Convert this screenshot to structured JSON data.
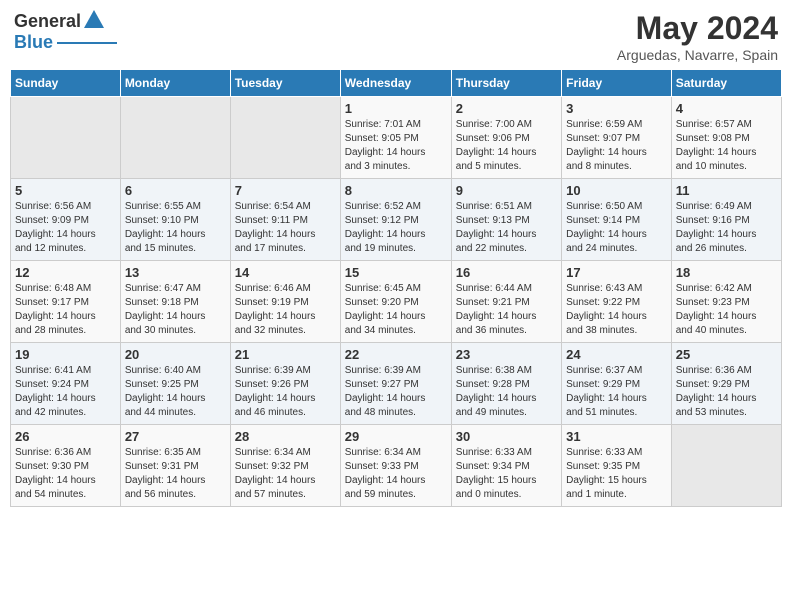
{
  "logo": {
    "general": "General",
    "blue": "Blue"
  },
  "header": {
    "title": "May 2024",
    "subtitle": "Arguedas, Navarre, Spain"
  },
  "columns": [
    "Sunday",
    "Monday",
    "Tuesday",
    "Wednesday",
    "Thursday",
    "Friday",
    "Saturday"
  ],
  "weeks": [
    [
      {
        "day": "",
        "info": ""
      },
      {
        "day": "",
        "info": ""
      },
      {
        "day": "",
        "info": ""
      },
      {
        "day": "1",
        "info": "Sunrise: 7:01 AM\nSunset: 9:05 PM\nDaylight: 14 hours\nand 3 minutes."
      },
      {
        "day": "2",
        "info": "Sunrise: 7:00 AM\nSunset: 9:06 PM\nDaylight: 14 hours\nand 5 minutes."
      },
      {
        "day": "3",
        "info": "Sunrise: 6:59 AM\nSunset: 9:07 PM\nDaylight: 14 hours\nand 8 minutes."
      },
      {
        "day": "4",
        "info": "Sunrise: 6:57 AM\nSunset: 9:08 PM\nDaylight: 14 hours\nand 10 minutes."
      }
    ],
    [
      {
        "day": "5",
        "info": "Sunrise: 6:56 AM\nSunset: 9:09 PM\nDaylight: 14 hours\nand 12 minutes."
      },
      {
        "day": "6",
        "info": "Sunrise: 6:55 AM\nSunset: 9:10 PM\nDaylight: 14 hours\nand 15 minutes."
      },
      {
        "day": "7",
        "info": "Sunrise: 6:54 AM\nSunset: 9:11 PM\nDaylight: 14 hours\nand 17 minutes."
      },
      {
        "day": "8",
        "info": "Sunrise: 6:52 AM\nSunset: 9:12 PM\nDaylight: 14 hours\nand 19 minutes."
      },
      {
        "day": "9",
        "info": "Sunrise: 6:51 AM\nSunset: 9:13 PM\nDaylight: 14 hours\nand 22 minutes."
      },
      {
        "day": "10",
        "info": "Sunrise: 6:50 AM\nSunset: 9:14 PM\nDaylight: 14 hours\nand 24 minutes."
      },
      {
        "day": "11",
        "info": "Sunrise: 6:49 AM\nSunset: 9:16 PM\nDaylight: 14 hours\nand 26 minutes."
      }
    ],
    [
      {
        "day": "12",
        "info": "Sunrise: 6:48 AM\nSunset: 9:17 PM\nDaylight: 14 hours\nand 28 minutes."
      },
      {
        "day": "13",
        "info": "Sunrise: 6:47 AM\nSunset: 9:18 PM\nDaylight: 14 hours\nand 30 minutes."
      },
      {
        "day": "14",
        "info": "Sunrise: 6:46 AM\nSunset: 9:19 PM\nDaylight: 14 hours\nand 32 minutes."
      },
      {
        "day": "15",
        "info": "Sunrise: 6:45 AM\nSunset: 9:20 PM\nDaylight: 14 hours\nand 34 minutes."
      },
      {
        "day": "16",
        "info": "Sunrise: 6:44 AM\nSunset: 9:21 PM\nDaylight: 14 hours\nand 36 minutes."
      },
      {
        "day": "17",
        "info": "Sunrise: 6:43 AM\nSunset: 9:22 PM\nDaylight: 14 hours\nand 38 minutes."
      },
      {
        "day": "18",
        "info": "Sunrise: 6:42 AM\nSunset: 9:23 PM\nDaylight: 14 hours\nand 40 minutes."
      }
    ],
    [
      {
        "day": "19",
        "info": "Sunrise: 6:41 AM\nSunset: 9:24 PM\nDaylight: 14 hours\nand 42 minutes."
      },
      {
        "day": "20",
        "info": "Sunrise: 6:40 AM\nSunset: 9:25 PM\nDaylight: 14 hours\nand 44 minutes."
      },
      {
        "day": "21",
        "info": "Sunrise: 6:39 AM\nSunset: 9:26 PM\nDaylight: 14 hours\nand 46 minutes."
      },
      {
        "day": "22",
        "info": "Sunrise: 6:39 AM\nSunset: 9:27 PM\nDaylight: 14 hours\nand 48 minutes."
      },
      {
        "day": "23",
        "info": "Sunrise: 6:38 AM\nSunset: 9:28 PM\nDaylight: 14 hours\nand 49 minutes."
      },
      {
        "day": "24",
        "info": "Sunrise: 6:37 AM\nSunset: 9:29 PM\nDaylight: 14 hours\nand 51 minutes."
      },
      {
        "day": "25",
        "info": "Sunrise: 6:36 AM\nSunset: 9:29 PM\nDaylight: 14 hours\nand 53 minutes."
      }
    ],
    [
      {
        "day": "26",
        "info": "Sunrise: 6:36 AM\nSunset: 9:30 PM\nDaylight: 14 hours\nand 54 minutes."
      },
      {
        "day": "27",
        "info": "Sunrise: 6:35 AM\nSunset: 9:31 PM\nDaylight: 14 hours\nand 56 minutes."
      },
      {
        "day": "28",
        "info": "Sunrise: 6:34 AM\nSunset: 9:32 PM\nDaylight: 14 hours\nand 57 minutes."
      },
      {
        "day": "29",
        "info": "Sunrise: 6:34 AM\nSunset: 9:33 PM\nDaylight: 14 hours\nand 59 minutes."
      },
      {
        "day": "30",
        "info": "Sunrise: 6:33 AM\nSunset: 9:34 PM\nDaylight: 15 hours\nand 0 minutes."
      },
      {
        "day": "31",
        "info": "Sunrise: 6:33 AM\nSunset: 9:35 PM\nDaylight: 15 hours\nand 1 minute."
      },
      {
        "day": "",
        "info": ""
      }
    ]
  ]
}
